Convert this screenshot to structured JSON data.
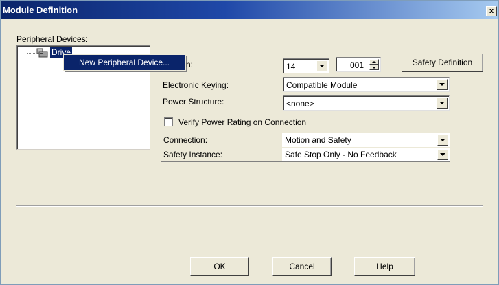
{
  "window": {
    "title": "Module Definition",
    "close_label": "x"
  },
  "peripheral": {
    "label": "Peripheral Devices:",
    "tree_item": "Drive",
    "context_menu_item": "New Peripheral Device..."
  },
  "revision": {
    "label_fragment": "n:",
    "major": "14",
    "minor": "001"
  },
  "safety_definition_label": "Safety Definition",
  "electronic_keying": {
    "label": "Electronic Keying:",
    "value": "Compatible Module"
  },
  "power_structure": {
    "label": "Power Structure:",
    "value": "<none>"
  },
  "verify_power": {
    "label": "Verify Power Rating on Connection",
    "checked": false
  },
  "grid": {
    "rows": [
      {
        "label": "Connection:",
        "value": "Motion and Safety"
      },
      {
        "label": "Safety Instance:",
        "value": "Safe Stop Only - No Feedback"
      }
    ]
  },
  "buttons": {
    "ok": "OK",
    "cancel": "Cancel",
    "help": "Help"
  }
}
